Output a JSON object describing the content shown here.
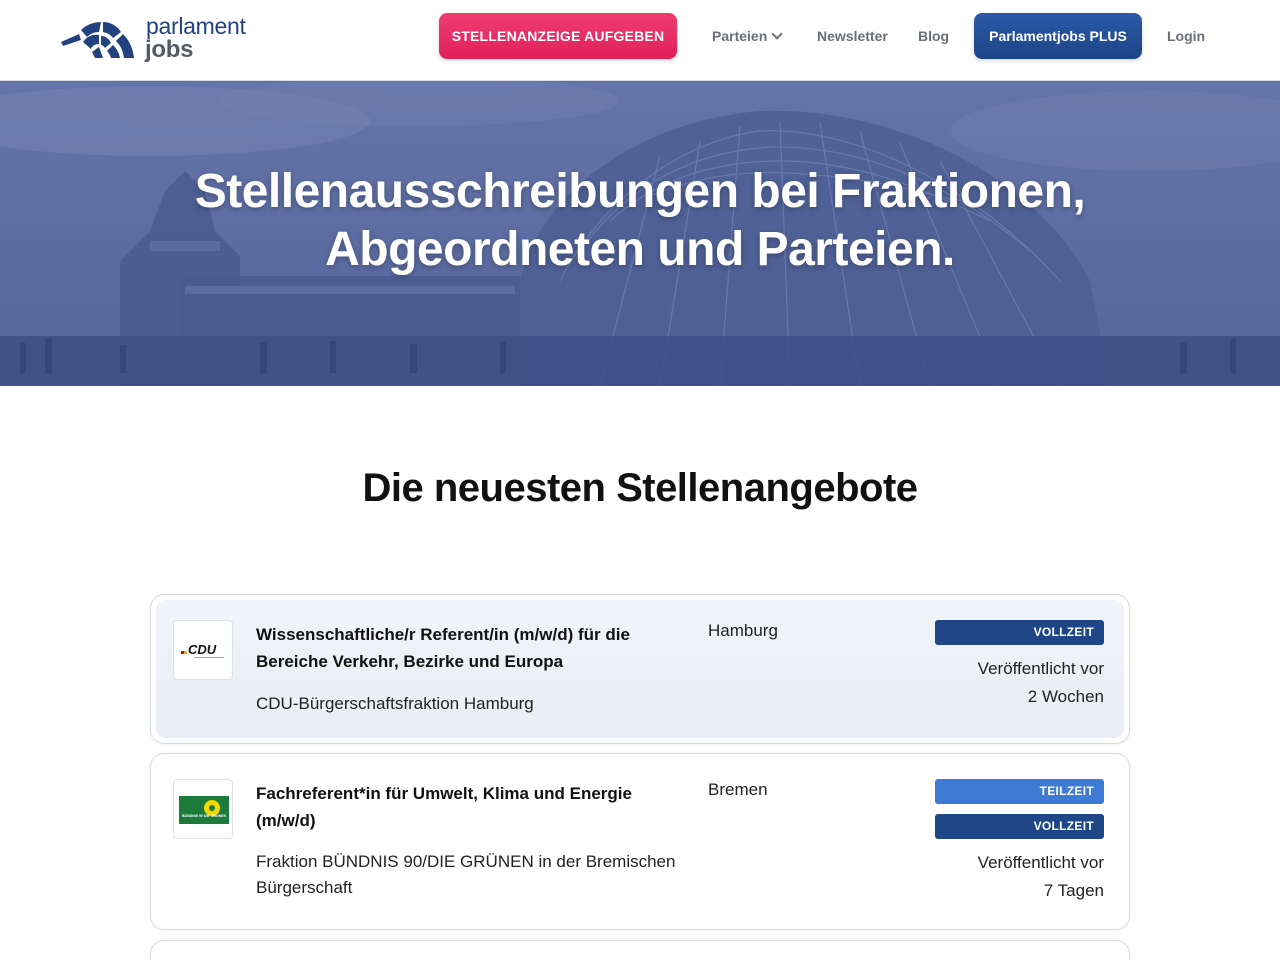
{
  "header": {
    "logo_line1": "parlament",
    "logo_line2": "jobs",
    "post_button": "STELLENANZEIGE AUFGEBEN",
    "nav": {
      "parteien": "Parteien",
      "newsletter": "Newsletter",
      "blog": "Blog",
      "plus": "Parlamentjobs PLUS",
      "login": "Login"
    }
  },
  "hero": {
    "title_line1": "Stellenausschreibungen bei Fraktionen,",
    "title_line2": "Abgeordneten und Parteien."
  },
  "section": {
    "title": "Die neuesten Stellenangebote"
  },
  "jobs": [
    {
      "logo": "cdu-logo",
      "logo_text": "CDU",
      "title": "Wissenschaftliche/r Referent/in (m/w/d) für die Bereiche Verkehr, Bezirke und Europa",
      "organization": "CDU-Bürgerschaftsfraktion Hamburg",
      "location": "Hamburg",
      "badges": [
        "VOLLZEIT"
      ],
      "published_line1": "Veröffentlicht vor",
      "published_line2": "2 Wochen"
    },
    {
      "logo": "gruene-logo",
      "logo_text": "BÜNDNIS 90 DIE GRÜNEN",
      "title": "Fachreferent*in für Umwelt, Klima und Energie (m/w/d)",
      "organization": "Fraktion BÜNDNIS 90/DIE GRÜNEN in der Bremischen Bürgerschaft",
      "location": "Bremen",
      "badges": [
        "TEILZEIT",
        "VOLLZEIT"
      ],
      "published_line1": "Veröffentlicht vor",
      "published_line2": "7 Tagen"
    }
  ],
  "colors": {
    "accent_pink": "#e0205b",
    "brand_blue": "#1f4788",
    "part_time_blue": "#3f7bd4",
    "hero_overlay": "#56669b"
  }
}
